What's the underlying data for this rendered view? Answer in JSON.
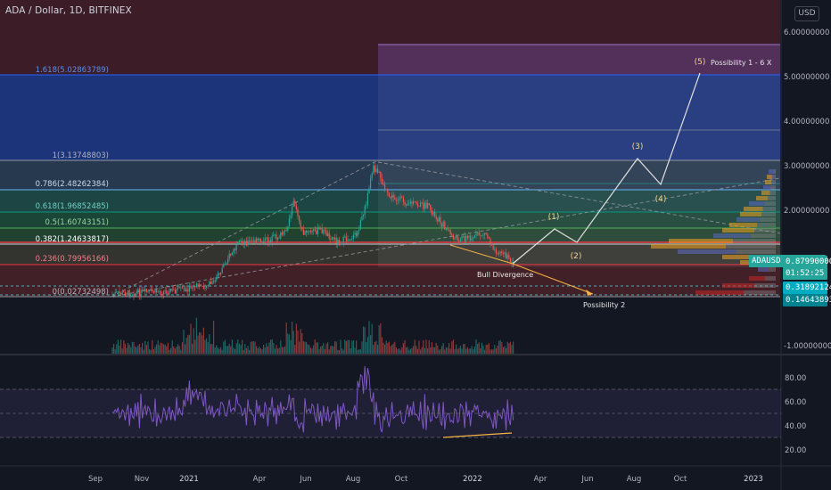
{
  "header": {
    "symbol_title": "ADA / Dollar, 1D, BITFINEX",
    "currency_button": "USD"
  },
  "price_axis": {
    "labels": [
      "6.00000000",
      "5.00000000",
      "4.00000000",
      "3.00000000",
      "2.00000000",
      "-1.00000000"
    ],
    "tags": {
      "symbol": "ADAUSD",
      "current_price": "0.87990000",
      "countdown": "01:52:25",
      "level_a": "0.31892124",
      "level_b": "0.14643893"
    }
  },
  "rsi_axis": {
    "labels": [
      "80.00",
      "60.00",
      "40.00",
      "20.00"
    ]
  },
  "time_axis": {
    "labels": [
      "Sep",
      "Nov",
      "2021",
      "Apr",
      "Jun",
      "Aug",
      "Oct",
      "2022",
      "Apr",
      "Jun",
      "Aug",
      "Oct",
      "2023"
    ]
  },
  "fib_levels": [
    {
      "ratio": "1.618",
      "label": "1.618(5.02863789)",
      "color": "#2962ff"
    },
    {
      "ratio": "1",
      "label": "1(3.13748803)",
      "color": "#787b86"
    },
    {
      "ratio": "0.786",
      "label": "0.786(2.48262384)",
      "color": "#64b5f6"
    },
    {
      "ratio": "0.618",
      "label": "0.618(1.96852485)",
      "color": "#089981"
    },
    {
      "ratio": "0.5",
      "label": "0.5(1.60743151)",
      "color": "#4caf50"
    },
    {
      "ratio": "0.382",
      "label": "0.382(1.24633817)",
      "color": "#ffffff"
    },
    {
      "ratio": "0.236",
      "label": "0.236(0.79956166)",
      "color": "#f23645"
    },
    {
      "ratio": "0",
      "label": "0(0.02732498)",
      "color": "#787b86"
    }
  ],
  "annotations": {
    "wave_1": "(1)",
    "wave_2": "(2)",
    "wave_3": "(3)",
    "wave_4": "(4)",
    "wave_5": "(5)",
    "possibility_1": "Possibility 1 - 6 X",
    "possibility_2": "Possibility 2",
    "bull_divergence": "Bull Divergence"
  },
  "colors": {
    "background": "#131722",
    "price_line": "#f23645",
    "rsi_line": "#7e57c2",
    "up_candle": "#26a69a",
    "down_candle": "#ef5350",
    "projection": "#e0e0e0",
    "divergence": "#f5b342"
  }
}
